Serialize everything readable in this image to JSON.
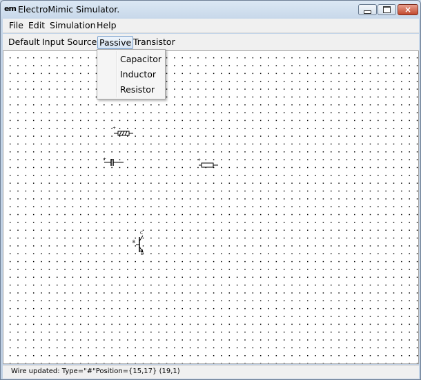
{
  "window": {
    "app_icon": "em",
    "title": "ElectroMimic Simulator.",
    "controls": {
      "close": "×"
    }
  },
  "menubar": {
    "items": [
      "File",
      "Edit",
      "Simulation",
      "Help"
    ]
  },
  "toolbar": {
    "tabs": [
      "Default",
      "Input Sources",
      "Passive",
      "Transistor"
    ],
    "active_tab": "Passive"
  },
  "dropdown": {
    "items": [
      "Capacitor",
      "Inductor",
      "Resistor"
    ]
  },
  "canvas": {
    "components": [
      {
        "kind": "inductor-symbol",
        "label": "+"
      },
      {
        "kind": "capacitor-symbol",
        "label": "+"
      },
      {
        "kind": "resistor-symbol",
        "label": "+"
      },
      {
        "kind": "transistor-symbol",
        "pins": [
          "C",
          "B",
          "E"
        ]
      }
    ]
  },
  "status": {
    "text": "Wire updated: Type=\"#\"Position={15,17} (19,1)"
  },
  "colors": {
    "titlebar": "#c4d5e8",
    "chrome": "#f0f0f0",
    "canvas": "#ffffff",
    "active_tab_border": "#7da2ce",
    "close_button": "#c24a2f"
  }
}
